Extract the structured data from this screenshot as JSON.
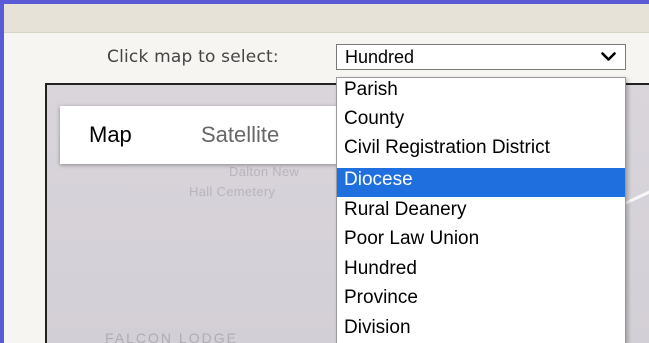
{
  "selector": {
    "label": "Click map to select:",
    "value": "Hundred",
    "chevron_icon": "chevron-down-icon"
  },
  "map_type": {
    "tabs": [
      "Map",
      "Satellite"
    ],
    "active": "Map"
  },
  "map_labels": [
    "Dalton New",
    "Hall Cemetery",
    "FALCON LODGE"
  ],
  "dropdown": {
    "options": [
      "Parish",
      "County",
      "Civil Registration District",
      "Diocese",
      "Rural Deanery",
      "Poor Law Union",
      "Hundred",
      "Province",
      "Division"
    ],
    "highlighted": "Diocese"
  },
  "colors": {
    "highlight": "#1f6fde",
    "frame": "#5a5ad6",
    "map": "#d7d3d9"
  }
}
